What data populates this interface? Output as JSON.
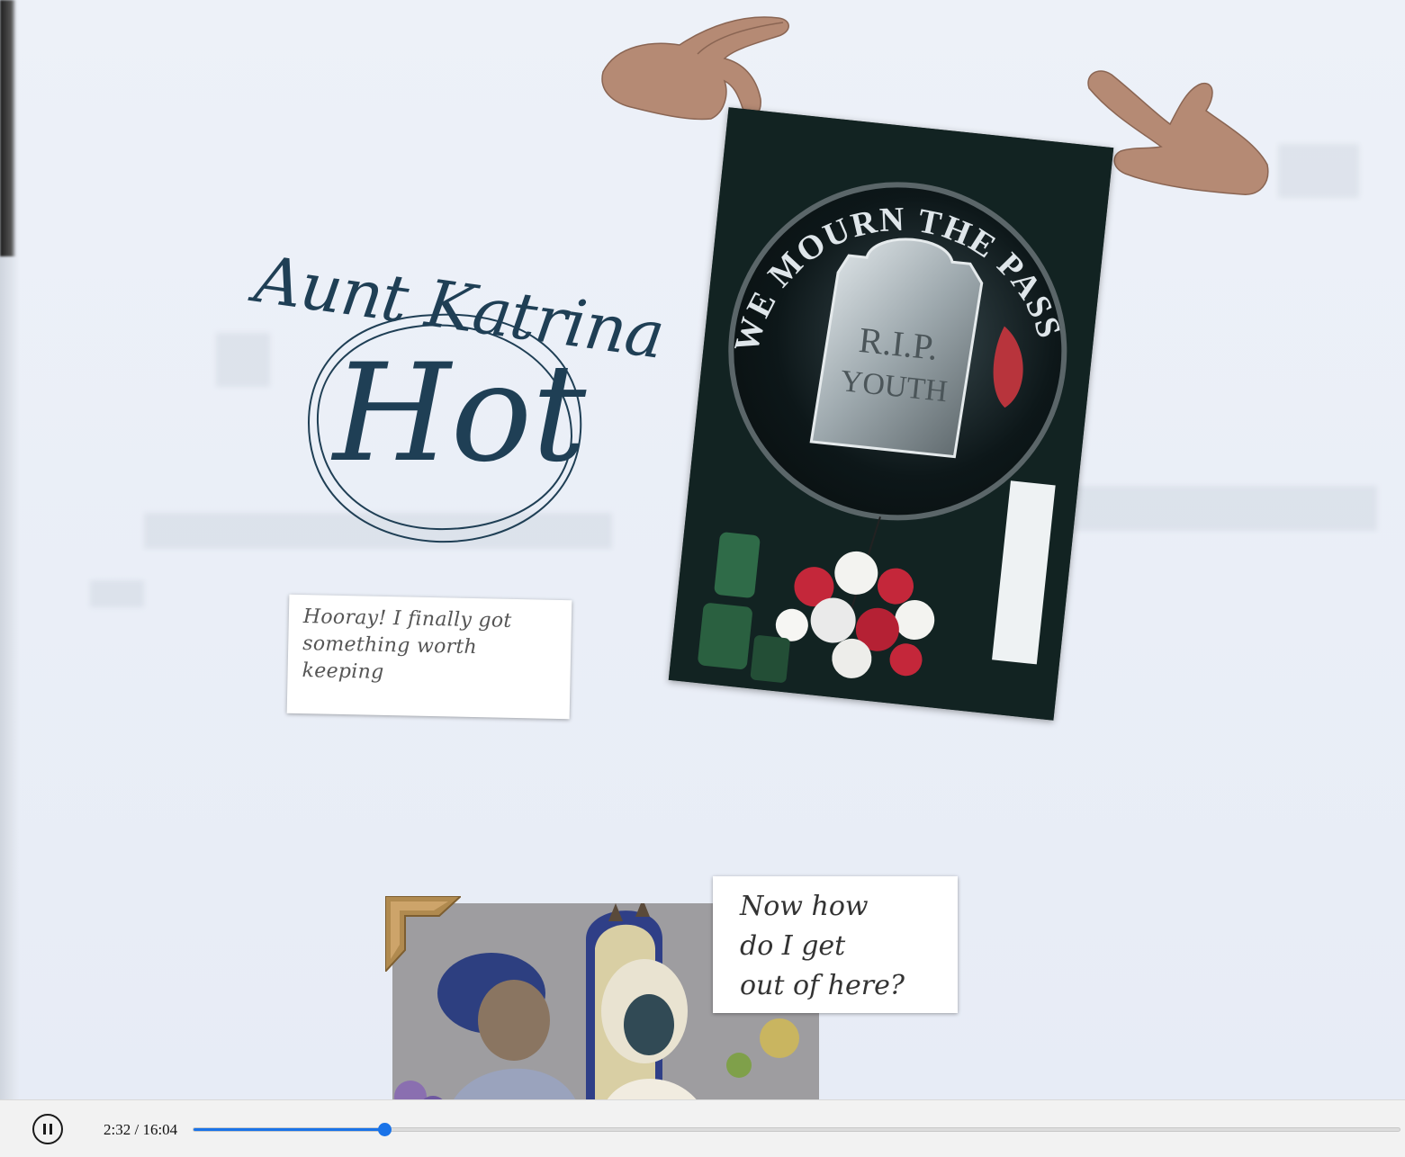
{
  "scene": {
    "aunt_name": "Aunt Katrina",
    "hot_word": "Hot",
    "note_hooray": "Hooray! I finally got something worth keeping",
    "note_escape_line1": "Now how",
    "note_escape_line2": "do I get",
    "note_escape_line3": "out of here?",
    "poster_arc_text": "WE MOURN THE PASSING OF YOUTH",
    "tombstone_line1": "R.I.P.",
    "tombstone_line2": "YOUTH",
    "ink_color": "#1f3f55"
  },
  "player": {
    "state": "playing",
    "current_time": "2:32",
    "duration": "16:04",
    "time_display": "2:32 / 16:04",
    "progress_fraction": 0.158,
    "accent_color": "#1a73e8",
    "play_pause_icon": "pause-icon"
  }
}
